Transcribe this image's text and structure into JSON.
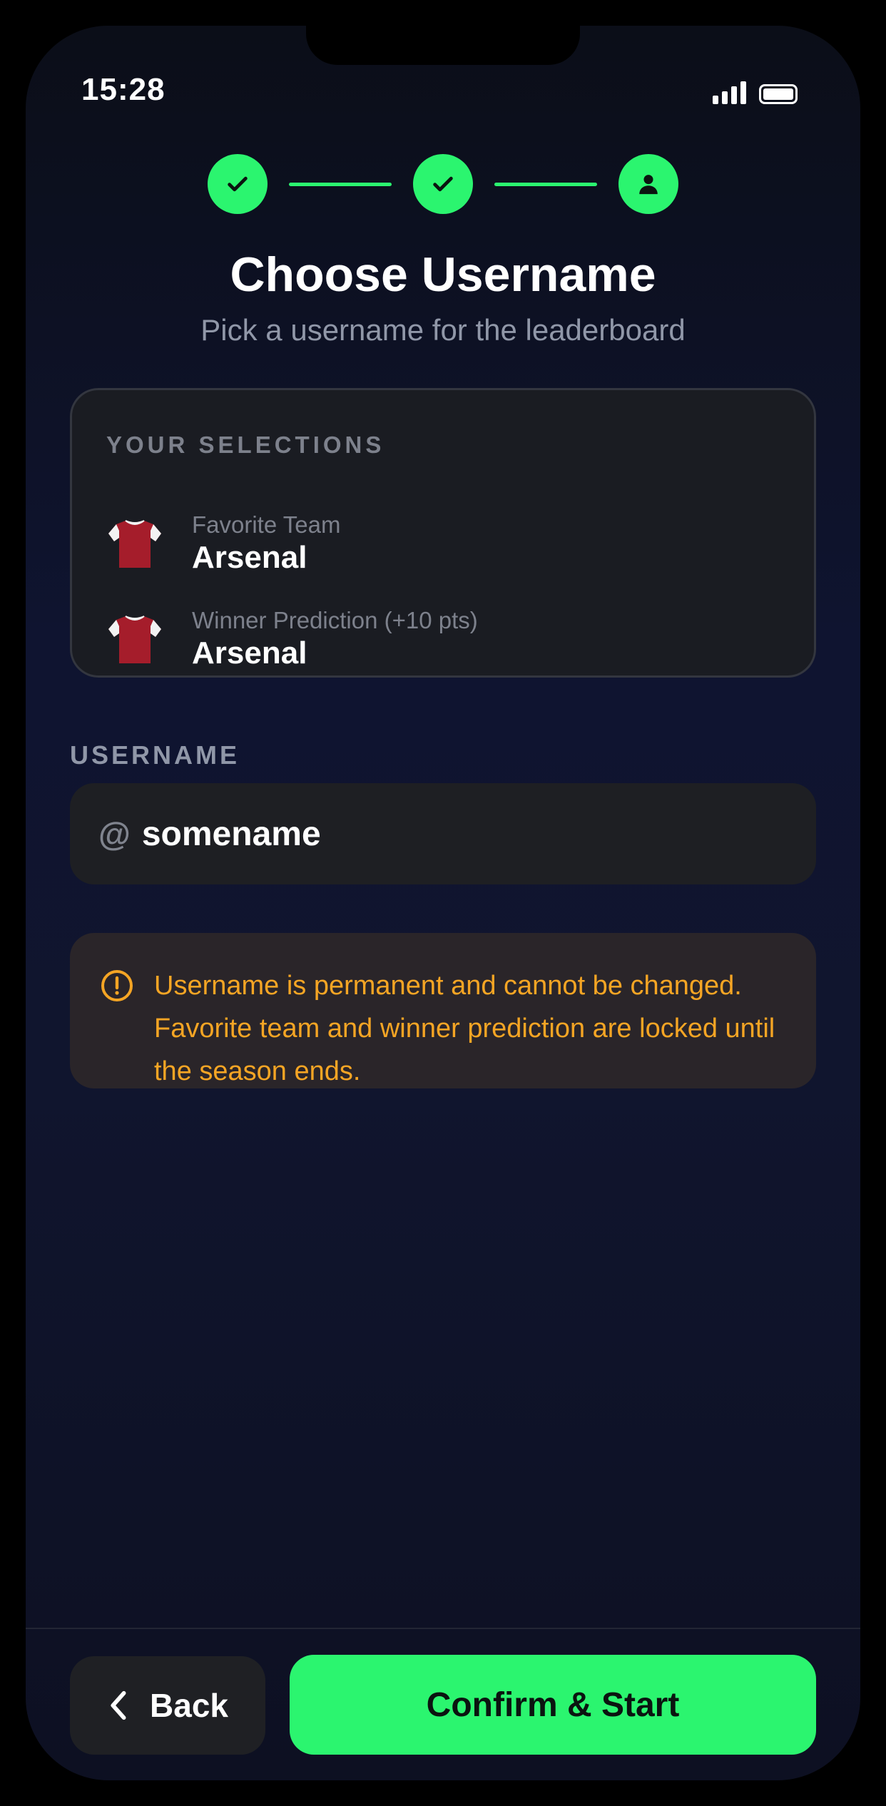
{
  "status_bar": {
    "time": "15:28"
  },
  "colors": {
    "accent": "#2bf56f",
    "warning": "#f5a524",
    "background": "#0f1430",
    "jersey_red": "#a51d2b"
  },
  "stepper": {
    "steps": [
      {
        "state": "completed",
        "icon": "check-icon"
      },
      {
        "state": "completed",
        "icon": "check-icon"
      },
      {
        "state": "current",
        "icon": "user-icon"
      }
    ]
  },
  "header": {
    "title": "Choose Username",
    "subtitle": "Pick a username for the leaderboard"
  },
  "selections": {
    "heading": "YOUR SELECTIONS",
    "items": [
      {
        "icon": "jersey-icon",
        "label": "Favorite Team",
        "value": "Arsenal"
      },
      {
        "icon": "jersey-icon",
        "label": "Winner Prediction (+10 pts)",
        "value": "Arsenal"
      }
    ]
  },
  "username": {
    "label": "USERNAME",
    "prefix": "@",
    "value": "somename"
  },
  "warning": {
    "icon": "alert-circle-icon",
    "text": "Username is permanent and cannot be changed. Favorite team and winner prediction are locked until the season ends."
  },
  "footer": {
    "back_label": "Back",
    "confirm_label": "Confirm & Start"
  }
}
